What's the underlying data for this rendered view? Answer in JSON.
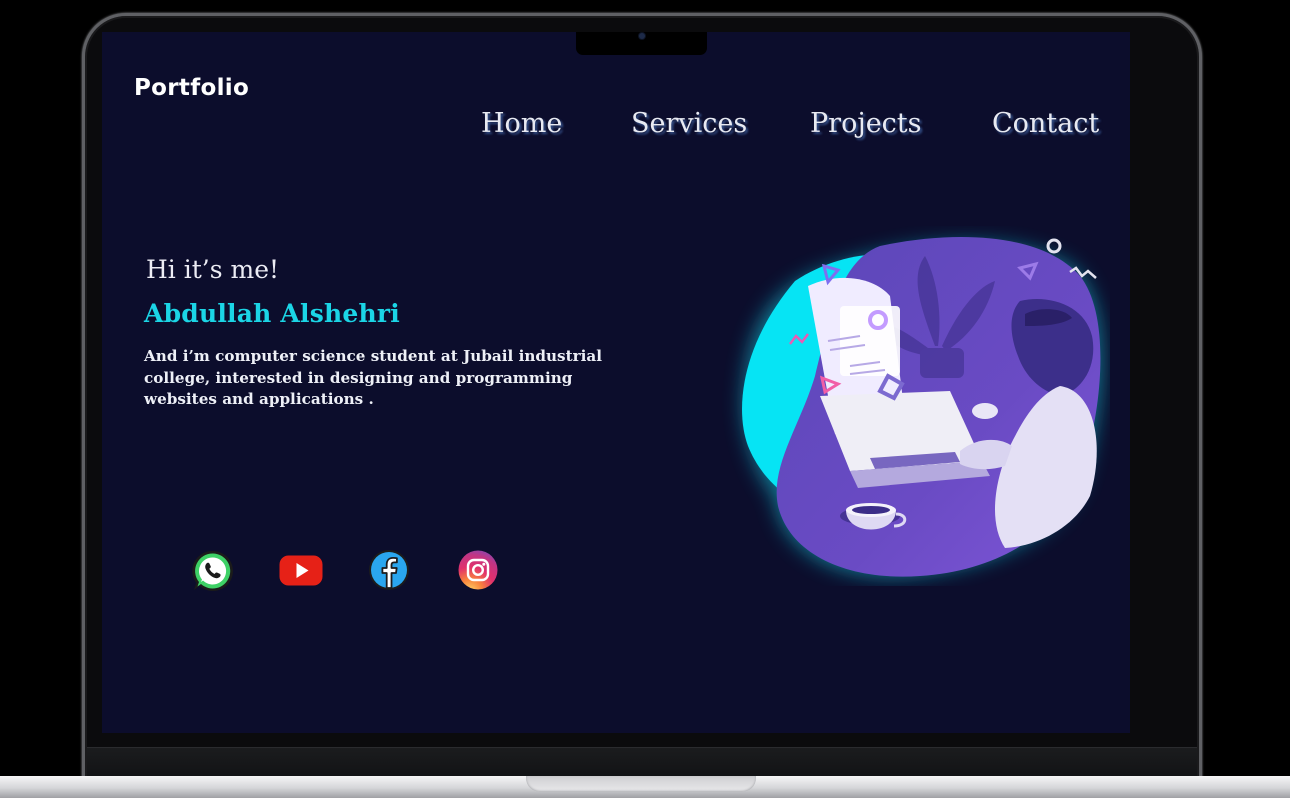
{
  "site": {
    "logo": "Portfolio"
  },
  "nav": {
    "home": "Home",
    "services": "Services",
    "projects": "Projects",
    "contact": "Contact"
  },
  "hero": {
    "greeting": "Hi it’s me!",
    "name": "Abdullah Alshehri",
    "bio": "And i’m computer science student at Jubail industrial college, interested in designing and  programming websites and applications ."
  },
  "social": [
    {
      "icon": "whatsapp-icon",
      "color": "#25d366"
    },
    {
      "icon": "youtube-icon",
      "color": "#e62117"
    },
    {
      "icon": "facebook-icon",
      "color": "#2aa6ee"
    },
    {
      "icon": "instagram-icon",
      "color": "#d62976"
    }
  ],
  "colors": {
    "background": "#0c0d2c",
    "accent": "#1bd5e6",
    "illustration_purple": "#6a4bc4"
  }
}
